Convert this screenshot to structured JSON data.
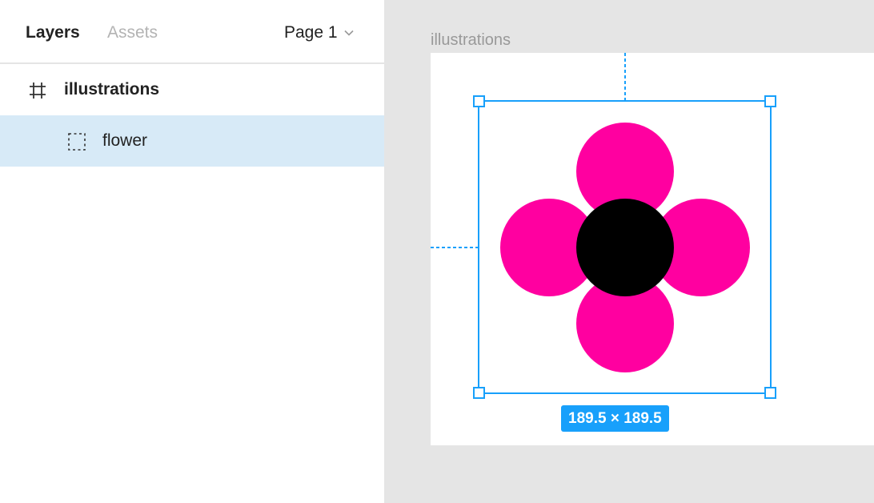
{
  "panel": {
    "tabs": [
      {
        "label": "Layers",
        "active": true
      },
      {
        "label": "Assets",
        "active": false
      }
    ],
    "page_selector": {
      "label": "Page 1",
      "icon": "chevron-down-icon"
    },
    "layers": [
      {
        "label": "illustrations",
        "icon": "frame-hash-icon",
        "selected": false
      },
      {
        "label": "flower",
        "icon": "group-dashed-square-icon",
        "selected": true
      }
    ]
  },
  "canvas": {
    "frame_label": "illustrations",
    "selection_size": "189.5 × 189.5"
  },
  "colors": {
    "petal": "#ff00a0",
    "center": "#000000",
    "selection": "#18a0fb",
    "selected_row": "#d7eaf7"
  }
}
